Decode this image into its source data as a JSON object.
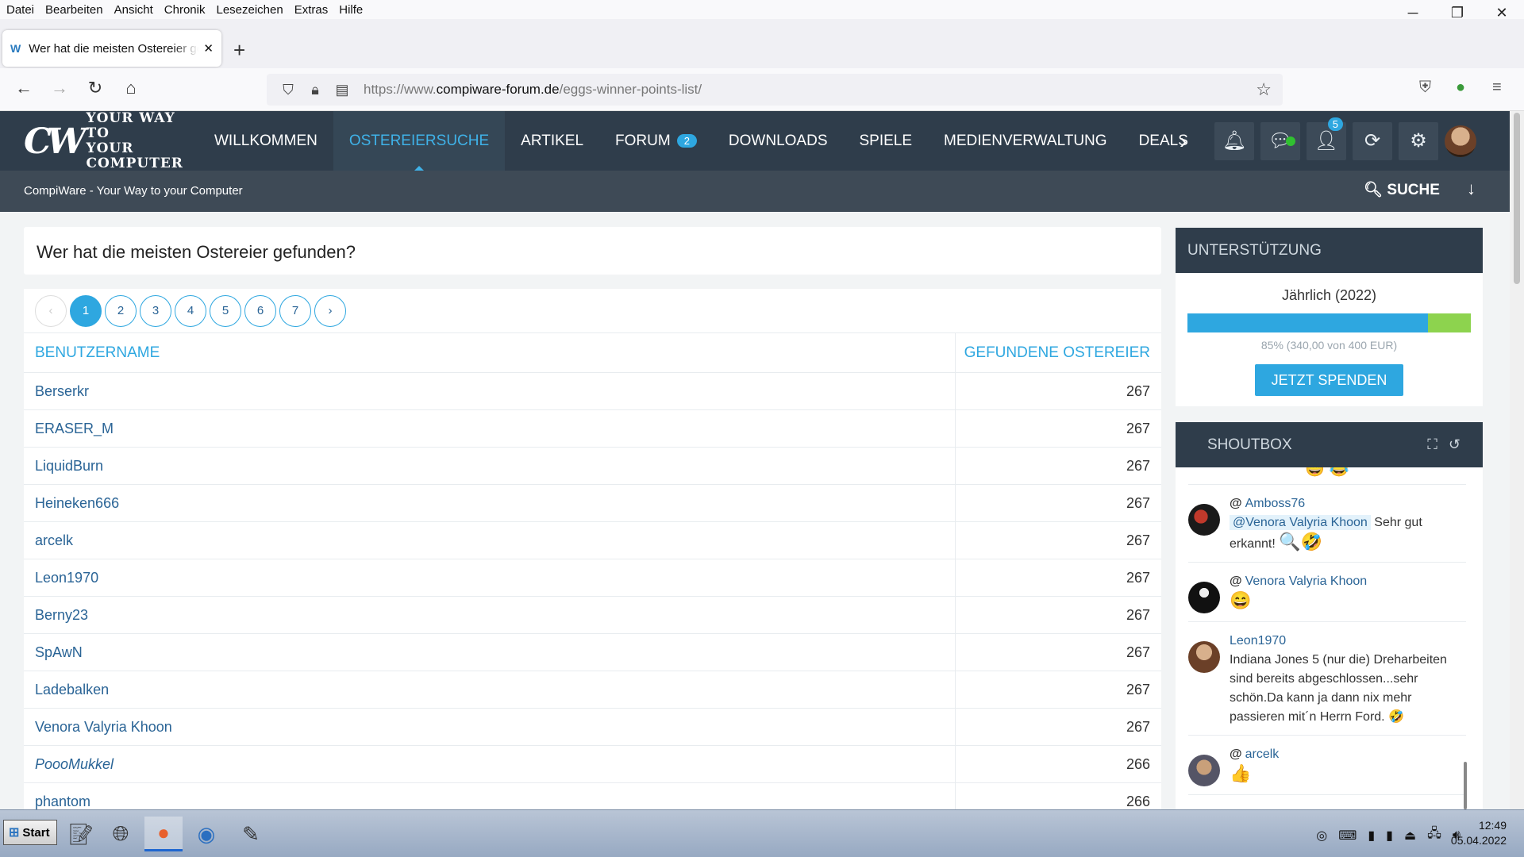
{
  "browser": {
    "menu": [
      "Datei",
      "Bearbeiten",
      "Ansicht",
      "Chronik",
      "Lesezeichen",
      "Extras",
      "Hilfe"
    ],
    "tab_title": "Wer hat die meisten Ostereier gefunden?",
    "url_prefix": "https://www.",
    "url_domain": "compiware-forum.de",
    "url_path": "/eggs-winner-points-list/"
  },
  "site": {
    "logo_mark": "CW",
    "logo_slogan_line1": "YOUR WAY TO",
    "logo_slogan_line2": "YOUR COMPUTER",
    "nav": [
      {
        "label": "WILLKOMMEN"
      },
      {
        "label": "OSTEREIERSUCHE"
      },
      {
        "label": "ARTIKEL"
      },
      {
        "label": "FORUM",
        "badge": "2"
      },
      {
        "label": "DOWNLOADS"
      },
      {
        "label": "SPIELE"
      },
      {
        "label": "MEDIENVERWALTUNG"
      },
      {
        "label": "DEALS"
      }
    ],
    "notification_count": "5",
    "breadcrumb": "CompiWare - Your Way to your Computer",
    "search_label": "SUCHE"
  },
  "page": {
    "title": "Wer hat die meisten Ostereier gefunden?",
    "pages": [
      "1",
      "2",
      "3",
      "4",
      "5",
      "6",
      "7"
    ],
    "current_page": "1",
    "columns": [
      "BENUTZERNAME",
      "GEFUNDENE OSTEREIER"
    ],
    "rows": [
      {
        "user": "Berserkr",
        "eggs": "267"
      },
      {
        "user": "ERASER_M",
        "eggs": "267"
      },
      {
        "user": "LiquidBurn",
        "eggs": "267"
      },
      {
        "user": "Heineken666",
        "eggs": "267"
      },
      {
        "user": "arcelk",
        "eggs": "267"
      },
      {
        "user": "Leon1970",
        "eggs": "267"
      },
      {
        "user": "Berny23",
        "eggs": "267"
      },
      {
        "user": "SpAwN",
        "eggs": "267"
      },
      {
        "user": "Ladebalken",
        "eggs": "267"
      },
      {
        "user": "Venora Valyria Khoon",
        "eggs": "267"
      },
      {
        "user": "PoooMukkel",
        "eggs": "266"
      },
      {
        "user": "phantom",
        "eggs": "266"
      }
    ]
  },
  "support": {
    "heading": "UNTERSTÜTZUNG",
    "period": "Jährlich (2022)",
    "progress_fraction": 0.85,
    "progress_text": "85% (340,00 von 400 EUR)",
    "button": "JETZT SPENDEN"
  },
  "shoutbox": {
    "heading": "SHOUTBOX",
    "messages": [
      {
        "user": "Amboss76",
        "mention": "@Venora Valyria Khoon",
        "text": "Sehr gut erkannt!",
        "emoji": "🔍🤣"
      },
      {
        "user": "Venora Valyria Khoon",
        "text": "",
        "emoji": "😄"
      },
      {
        "user": "Leon1970",
        "text": "Indiana Jones 5 (nur die) Dreharbeiten sind bereits abgeschlossen...sehr schön.Da kann ja dann nix mehr passieren mit´n Herrn Ford.",
        "emoji": "🤣"
      },
      {
        "user": "arcelk",
        "text": "",
        "emoji": "👍"
      }
    ]
  },
  "taskbar": {
    "start": "Start",
    "clock_time": "12:49",
    "clock_date": "05.04.2022"
  },
  "colors": {
    "accent": "#2ea7e0",
    "header_bg": "#2f3d4b",
    "subbar_bg": "#3e4a56",
    "progress_tail": "#8dd34e"
  }
}
